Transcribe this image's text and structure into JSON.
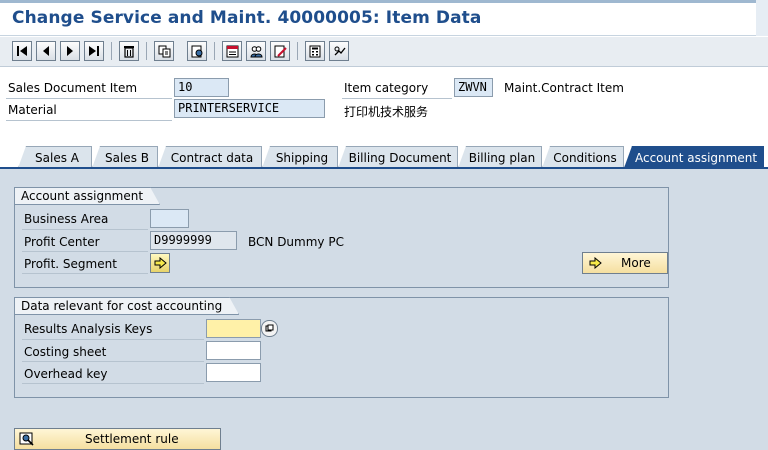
{
  "window": {
    "title": "Change Service and Maint. 40000005: Item Data"
  },
  "toolbar": {
    "buttons": [
      {
        "icon": "first-page-icon",
        "glyph": "⏮"
      },
      {
        "icon": "previous-page-icon",
        "glyph": "◀"
      },
      {
        "icon": "next-page-icon",
        "glyph": "▶"
      },
      {
        "icon": "last-page-icon",
        "glyph": "⏭"
      },
      {
        "icon": "delete-icon",
        "glyph": "🗑"
      },
      {
        "icon": "copy-icon",
        "glyph": "⎘"
      },
      {
        "icon": "display-document-icon",
        "glyph": "◉"
      },
      {
        "icon": "header-details-icon",
        "glyph": "⊞"
      },
      {
        "icon": "partner-icon",
        "glyph": "♚"
      },
      {
        "icon": "edit-icon",
        "glyph": "✎"
      },
      {
        "icon": "calculator-icon",
        "glyph": "▦"
      },
      {
        "icon": "configure-icon",
        "glyph": "⚙"
      }
    ]
  },
  "header": {
    "sales_doc_item_label": "Sales Document Item",
    "sales_doc_item_value": "10",
    "item_category_label": "Item category",
    "item_category_value": "ZWVN",
    "item_category_desc": "Maint.Contract Item",
    "material_label": "Material",
    "material_value": "PRINTERSERVICE",
    "material_desc": "打印机技术服务"
  },
  "tabs": [
    {
      "label": "Sales A",
      "active": false
    },
    {
      "label": "Sales B",
      "active": false
    },
    {
      "label": "Contract data",
      "active": false
    },
    {
      "label": "Shipping",
      "active": false
    },
    {
      "label": "Billing Document",
      "active": false
    },
    {
      "label": "Billing plan",
      "active": false
    },
    {
      "label": "Conditions",
      "active": false
    },
    {
      "label": "Account assignment",
      "active": true
    }
  ],
  "account_assignment": {
    "group_title": "Account assignment",
    "business_area_label": "Business Area",
    "business_area_value": "",
    "profit_center_label": "Profit Center",
    "profit_center_value": "D9999999",
    "profit_center_desc": "BCN Dummy PC",
    "profit_segment_label": "Profit. Segment",
    "more_button": "More"
  },
  "cost_accounting": {
    "group_title": "Data relevant for cost accounting",
    "results_analysis_label": "Results Analysis Keys",
    "results_analysis_value": "",
    "costing_sheet_label": "Costing sheet",
    "costing_sheet_value": "",
    "overhead_key_label": "Overhead key",
    "overhead_key_value": ""
  },
  "footer": {
    "settlement_rule_button": "Settlement rule"
  },
  "colors": {
    "title": "#1f4e8c",
    "active_tab": "#1f4e8c",
    "content_bg": "#d2dce6",
    "required_field": "#fff1a8"
  }
}
